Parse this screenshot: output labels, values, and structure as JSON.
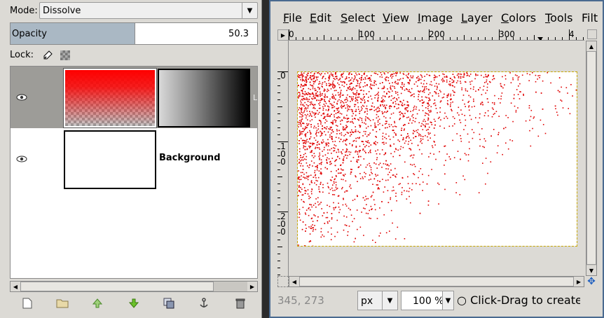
{
  "layers_dialog": {
    "mode_label": "Mode:",
    "mode_value": "Dissolve",
    "opacity_label": "Opacity",
    "opacity_value": "50.3",
    "opacity_fraction": 0.503,
    "lock_label": "Lock:",
    "layers": [
      {
        "name": "",
        "visible": true,
        "selected": true,
        "has_mask": true
      },
      {
        "name": "Background",
        "visible": true,
        "selected": false,
        "has_mask": false
      }
    ],
    "truncated_name_hint": "L",
    "buttons": [
      "new-layer-icon",
      "layer-group-icon",
      "raise-layer-icon",
      "lower-layer-icon",
      "duplicate-layer-icon",
      "anchor-layer-icon",
      "delete-layer-icon"
    ]
  },
  "image_window": {
    "menu": [
      {
        "label": "File",
        "u": "F",
        "rest": "ile"
      },
      {
        "label": "Edit",
        "u": "E",
        "rest": "dit"
      },
      {
        "label": "Select",
        "u": "S",
        "rest": "elect"
      },
      {
        "label": "View",
        "u": "V",
        "rest": "iew"
      },
      {
        "label": "Image",
        "u": "I",
        "rest": "mage"
      },
      {
        "label": "Layer",
        "u": "L",
        "rest": "ayer"
      },
      {
        "label": "Colors",
        "u": "C",
        "rest": "olors"
      },
      {
        "label": "Tools",
        "u": "T",
        "rest": "ools"
      },
      {
        "label": "Filt",
        "u": "",
        "rest": "Filt"
      }
    ],
    "hruler_labels": [
      "0",
      "100",
      "200",
      "300",
      "4"
    ],
    "vruler_labels": [
      "0",
      "100",
      "200"
    ],
    "status": {
      "coords": "345, 273",
      "unit": "px",
      "zoom": "100 %",
      "message": "Click-Drag to create a new layer"
    },
    "colors": {
      "dissolve_red": "#e00000",
      "selection_border": "#c8a800"
    }
  }
}
